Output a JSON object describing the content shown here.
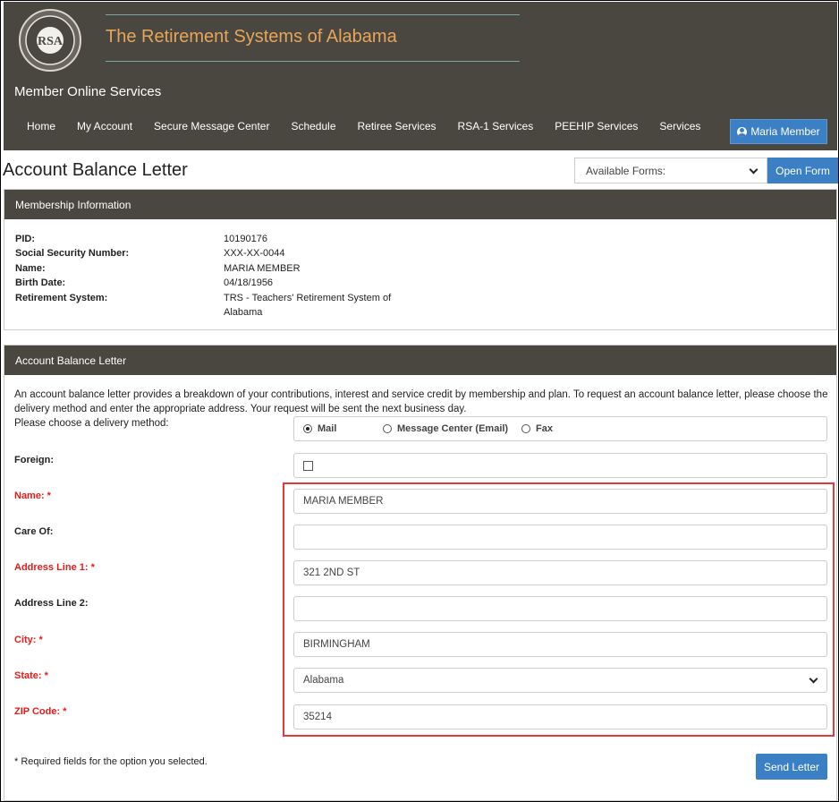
{
  "header": {
    "brand_title": "The Retirement Systems of Alabama",
    "subtitle": "Member Online Services",
    "logo_text": {
      "top": "RETIREMENT SYSTEMS",
      "center": "RSA",
      "bottom": "OF ALABAMA"
    },
    "nav": [
      "Home",
      "My Account",
      "Secure Message Center",
      "Schedule",
      "Retiree Services",
      "RSA-1 Services",
      "PEEHIP Services",
      "Services"
    ],
    "user_button": "Maria Member",
    "user_icon": "user-circle-icon"
  },
  "page": {
    "title": "Account Balance Letter",
    "forms_select": "Available Forms:",
    "open_form": "Open Form"
  },
  "membership": {
    "heading": "Membership Information",
    "rows": [
      {
        "label": "PID:",
        "value": "10190176"
      },
      {
        "label": "Social Security Number:",
        "value": "XXX-XX-0044"
      },
      {
        "label": "Name:",
        "value": "MARIA MEMBER"
      },
      {
        "label": "Birth Date:",
        "value": "04/18/1956"
      },
      {
        "label": "Retirement System:",
        "value": "TRS - Teachers' Retirement System of Alabama"
      }
    ]
  },
  "letter": {
    "heading": "Account Balance Letter",
    "description": "An account balance letter provides a breakdown of your contributions, interest and service credit by membership and plan. To request an account balance letter, please choose the delivery method and enter the appropriate address. Your request will be sent the next business day.",
    "delivery_label": "Please choose a delivery method:",
    "delivery_options": [
      "Mail",
      "Message Center (Email)",
      "Fax"
    ],
    "delivery_selected": "Mail",
    "foreign_label": "Foreign:",
    "fields": {
      "name": {
        "label": "Name: *",
        "value": "MARIA MEMBER"
      },
      "care_of": {
        "label": "Care Of:",
        "value": ""
      },
      "address1": {
        "label": "Address Line 1: *",
        "value": "321 2ND ST"
      },
      "address2": {
        "label": "Address Line 2:",
        "value": ""
      },
      "city": {
        "label": "City: *",
        "value": "BIRMINGHAM"
      },
      "state": {
        "label": "State: *",
        "value": "Alabama"
      },
      "zip": {
        "label": "ZIP Code: *",
        "value": "35214"
      }
    },
    "required_note": "* Required fields for the option you selected.",
    "send_button": "Send Letter"
  },
  "colors": {
    "header_bg": "#4a4740",
    "brand": "#e7a55a",
    "accent": "#3b7fc4",
    "required": "#e41b17",
    "highlight": "#e53a3a"
  }
}
